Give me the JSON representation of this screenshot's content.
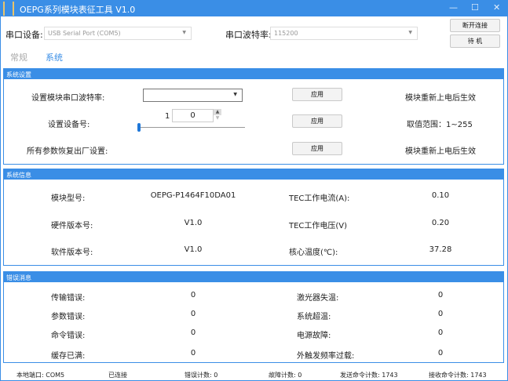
{
  "window": {
    "title": "OEPG系列模块表征工具   V1.0",
    "minimize": "—",
    "maximize": "☐",
    "close": "✕"
  },
  "top": {
    "port_label": "串口设备:",
    "port_value": "USB Serial Port (COM5)",
    "baud_label": "串口波特率:",
    "baud_value": "115200",
    "disconnect": "断开连接",
    "standby": "待 机"
  },
  "tabs": [
    "常规",
    "系统"
  ],
  "settings": {
    "title": "系统设置",
    "rows": [
      {
        "label": "设置模块串口波特率:",
        "apply": "应用",
        "note": "模块重新上电后生效"
      },
      {
        "label": "设置设备号:",
        "apply": "应用",
        "note": "取值范围：1~255"
      },
      {
        "label": "所有参数恢复出厂设置:",
        "apply": "应用",
        "note": "模块重新上电后生效"
      }
    ],
    "baud_select": "",
    "device_min": "1",
    "device_value": "0",
    "slider_fraction": 0
  },
  "info": {
    "title": "系统信息",
    "rows": [
      {
        "l1": "模块型号:",
        "v1": "OEPG-P1464F10DA01",
        "l2": "TEC工作电流(A):",
        "v2": "0.10"
      },
      {
        "l1": "硬件版本号:",
        "v1": "V1.0",
        "l2": "TEC工作电压(V)",
        "v2": "0.20"
      },
      {
        "l1": "软件版本号:",
        "v1": "V1.0",
        "l2": "核心温度(℃):",
        "v2": "37.28"
      }
    ]
  },
  "errors": {
    "title": "错误消息",
    "rows": [
      {
        "l1": "传输错误:",
        "v1": "0",
        "l2": "激光器失温:",
        "v2": "0"
      },
      {
        "l1": "参数错误:",
        "v1": "0",
        "l2": "系统超温:",
        "v2": "0"
      },
      {
        "l1": "命令错误:",
        "v1": "0",
        "l2": "电源故障:",
        "v2": "0"
      },
      {
        "l1": "缓存已满:",
        "v1": "0",
        "l2": "外触发频率过载:",
        "v2": "0"
      }
    ]
  },
  "status": {
    "port": "本地端口:  COM5",
    "conn": "已连接",
    "err": "错误计数:  0",
    "fault": "故障计数:  0",
    "sent": "发送命令计数:  1743",
    "recv": "接收命令计数:  1743"
  }
}
